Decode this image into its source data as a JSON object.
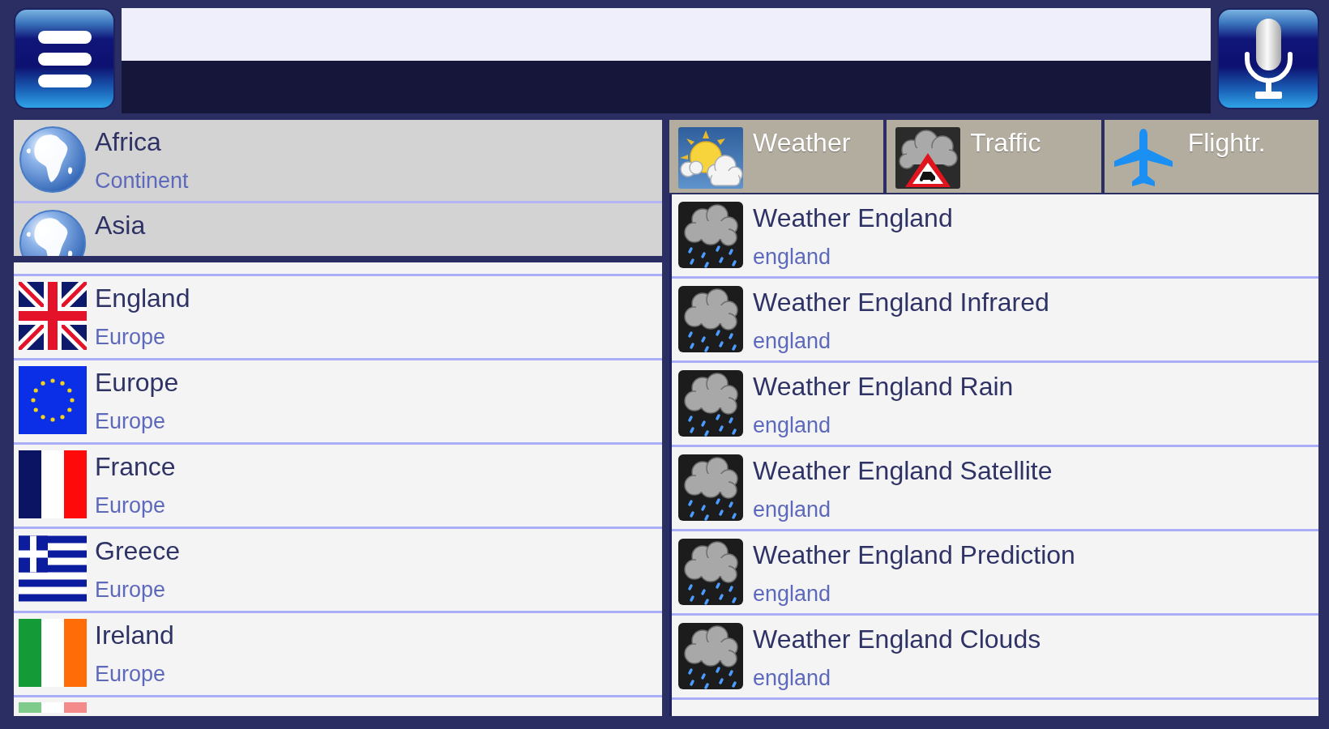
{
  "regions": [
    {
      "kind": "globe",
      "name": "Africa",
      "type": "Continent"
    },
    {
      "kind": "globe",
      "name": "Asia"
    }
  ],
  "countries": [
    {
      "kind": "uk",
      "name": "England",
      "region": "Europe"
    },
    {
      "kind": "eu",
      "name": "Europe",
      "region": "Europe"
    },
    {
      "kind": "france",
      "name": "France",
      "region": "Europe"
    },
    {
      "kind": "greece",
      "name": "Greece",
      "region": "Europe"
    },
    {
      "kind": "ireland",
      "name": "Ireland",
      "region": "Europe"
    },
    {
      "kind": "italy"
    }
  ],
  "tabs": [
    {
      "kind": "weather",
      "label": "Weather"
    },
    {
      "kind": "traffic",
      "label": "Traffic"
    },
    {
      "kind": "flight",
      "label": "Flightr."
    }
  ],
  "maps": [
    {
      "kind": "rain",
      "title": "Weather England",
      "region": "england"
    },
    {
      "kind": "rain",
      "title": "Weather England Infrared",
      "region": "england"
    },
    {
      "kind": "rain",
      "title": "Weather England Rain",
      "region": "england"
    },
    {
      "kind": "rain",
      "title": "Weather England Satellite",
      "region": "england"
    },
    {
      "kind": "rain",
      "title": "Weather England Prediction",
      "region": "england"
    },
    {
      "kind": "rain",
      "title": "Weather England Clouds",
      "region": "england"
    }
  ]
}
